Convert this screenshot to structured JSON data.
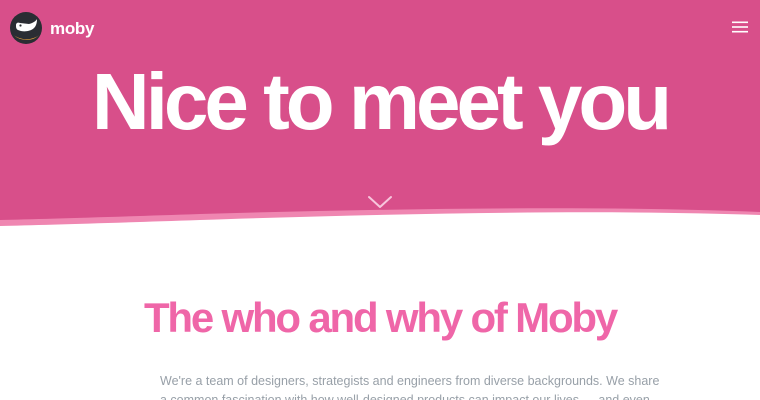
{
  "brand": {
    "name": "moby",
    "logo_icon": "moby-whale-logo-icon",
    "colors": {
      "hero_background": "#d84f8a",
      "hero_wave": "#ef86b1",
      "heading_accent": "#ef66a8",
      "body_text": "#98a0a8",
      "logo_badge": "#2a2d33"
    }
  },
  "nav": {
    "menu_icon": "hamburger-menu-icon"
  },
  "hero": {
    "title": "Nice to meet you",
    "scroll_icon": "chevron-down-icon"
  },
  "about": {
    "title": "The who and why of Moby",
    "intro_lines": [
      "We're a team of designers, strategists and engineers from diverse backgrounds. We share",
      "a common fascination with how well-designed products can impact our lives — and even"
    ]
  }
}
